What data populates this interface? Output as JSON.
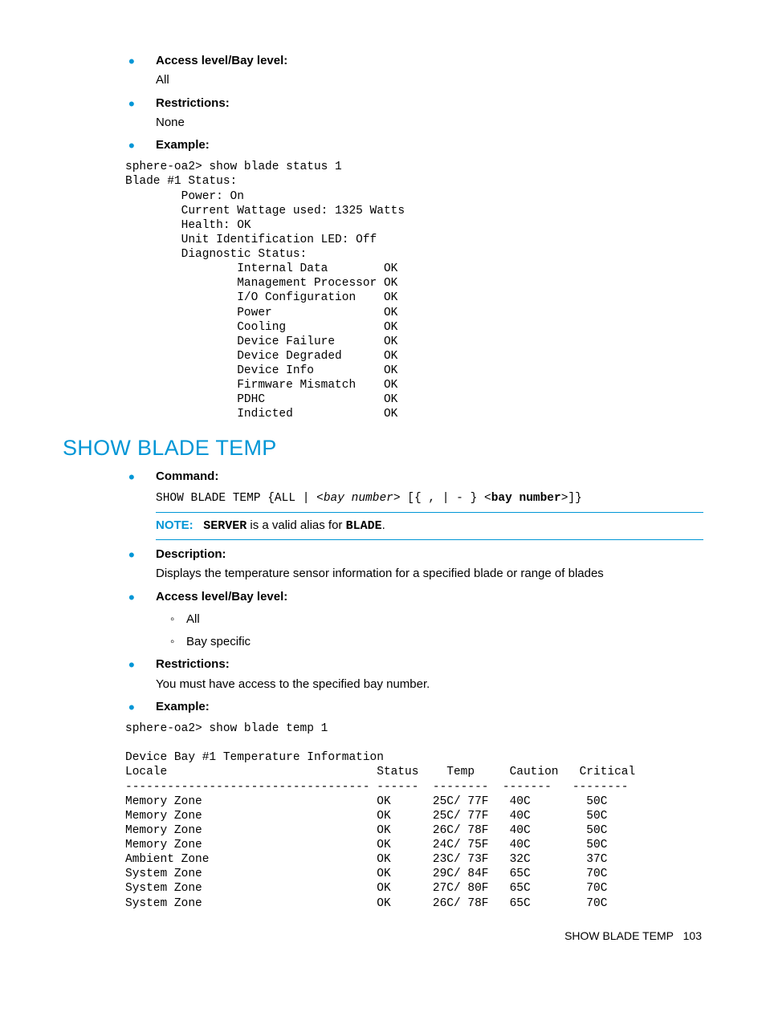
{
  "section1": {
    "items": [
      {
        "label": "Access level/Bay level:",
        "value": "All"
      },
      {
        "label": "Restrictions:",
        "value": "None"
      },
      {
        "label": "Example:",
        "value": ""
      }
    ],
    "code": "sphere-oa2> show blade status 1\nBlade #1 Status:\n        Power: On\n        Current Wattage used: 1325 Watts\n        Health: OK\n        Unit Identification LED: Off\n        Diagnostic Status:\n                Internal Data        OK\n                Management Processor OK\n                I/O Configuration    OK\n                Power                OK\n                Cooling              OK\n                Device Failure       OK\n                Device Degraded      OK\n                Device Info          OK\n                Firmware Mismatch    OK\n                PDHC                 OK\n                Indicted             OK"
  },
  "section2": {
    "heading": "SHOW BLADE TEMP",
    "command_label": "Command:",
    "command_prefix": "SHOW BLADE TEMP {ALL | <",
    "command_italic1": "bay number",
    "command_mid": "> [{ , | - } <",
    "command_bold": "bay number",
    "command_suffix": ">]}",
    "note_word": "NOTE:",
    "note_server": "SERVER",
    "note_mid": " is a valid alias for ",
    "note_blade": "BLADE",
    "note_end": ".",
    "desc_label": "Description:",
    "desc_value": "Displays the temperature sensor information for a specified blade or range of blades",
    "access_label": "Access level/Bay level:",
    "access_sub": [
      "All",
      "Bay specific"
    ],
    "restr_label": "Restrictions:",
    "restr_value": "You must have access to the specified bay number.",
    "example_label": "Example:",
    "code": "sphere-oa2> show blade temp 1\n\nDevice Bay #1 Temperature Information\nLocale                              Status    Temp     Caution   Critical\n----------------------------------- ------  --------  -------   --------\nMemory Zone                         OK      25C/ 77F   40C        50C\nMemory Zone                         OK      25C/ 77F   40C        50C\nMemory Zone                         OK      26C/ 78F   40C        50C\nMemory Zone                         OK      24C/ 75F   40C        50C\nAmbient Zone                        OK      23C/ 73F   32C        37C\nSystem Zone                         OK      29C/ 84F   65C        70C\nSystem Zone                         OK      27C/ 80F   65C        70C\nSystem Zone                         OK      26C/ 78F   65C        70C"
  },
  "footer": {
    "title": "SHOW BLADE TEMP",
    "page": "103"
  }
}
